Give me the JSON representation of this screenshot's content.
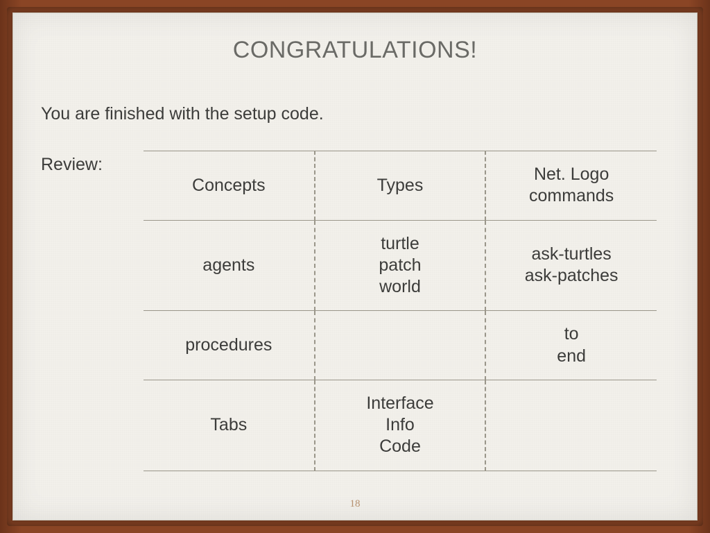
{
  "slide": {
    "title": "CONGRATULATIONS!",
    "subtitle": "You are finished with the setup code.",
    "review_label": "Review:",
    "page_number": "18",
    "table": {
      "header": {
        "c1": "Concepts",
        "c2": "Types",
        "c3": "Net. Logo\ncommands"
      },
      "rows": [
        {
          "c1": "agents",
          "c2": "turtle\npatch\nworld",
          "c3": "ask-turtles\nask-patches"
        },
        {
          "c1": "procedures",
          "c2": "",
          "c3": "to\nend"
        },
        {
          "c1": "Tabs",
          "c2": "Interface\nInfo\nCode",
          "c3": ""
        }
      ]
    }
  }
}
